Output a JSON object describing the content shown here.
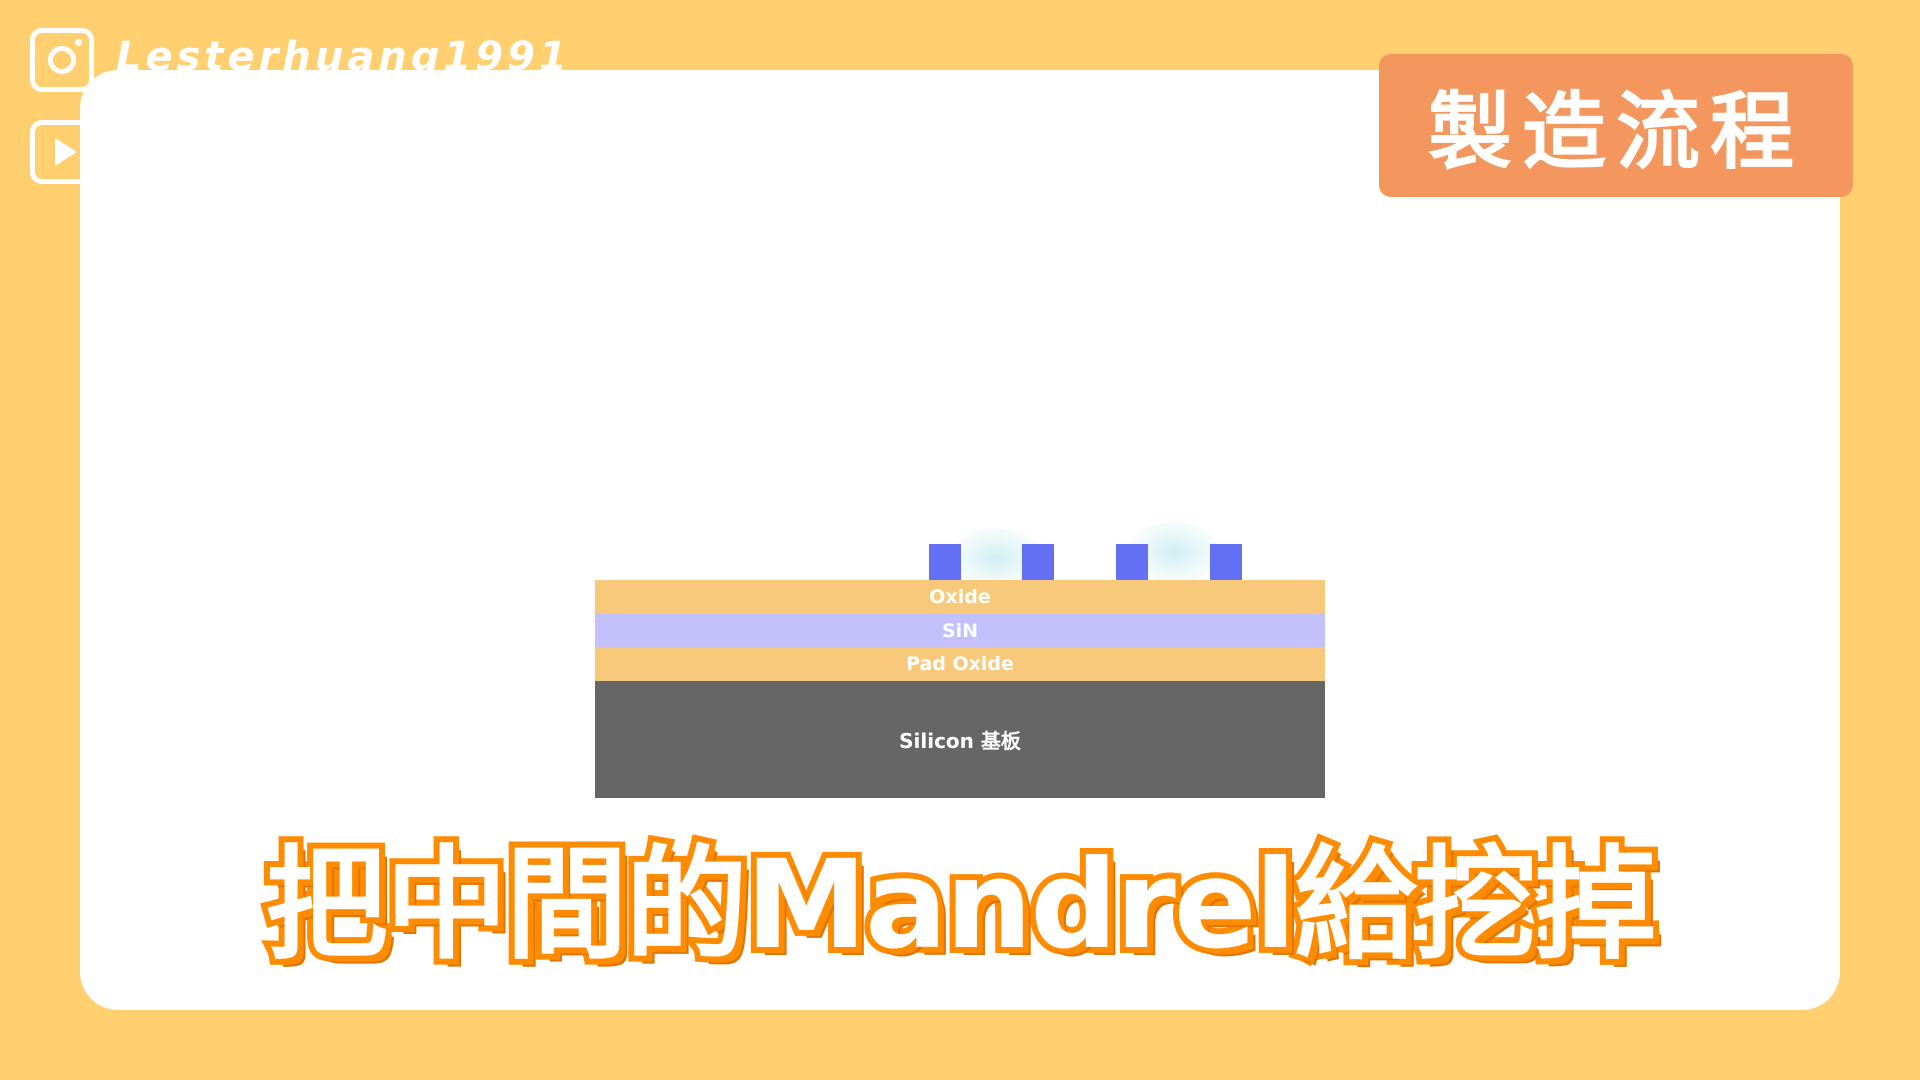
{
  "social": {
    "handle": "Lesterhuang1991",
    "icons": [
      "instagram-icon",
      "youtube-icon"
    ]
  },
  "badge": {
    "label": "製造流程"
  },
  "diagram": {
    "layers": {
      "oxide": "Oxide",
      "sin": "SiN",
      "pad_oxide": "Pad Oxide",
      "silicon": "Silicon 基板"
    },
    "mandrel_count": 4
  },
  "subtitle": {
    "text": "把中間的Mandrel給挖掉"
  },
  "colors": {
    "background": "#FFCF70",
    "badge": "#F3975E",
    "oxide": "#F8C97A",
    "sin": "#C3C0FB",
    "silicon": "#666666",
    "mandrel": "#6470F3",
    "subtitle_outline": "#FF8C00"
  }
}
